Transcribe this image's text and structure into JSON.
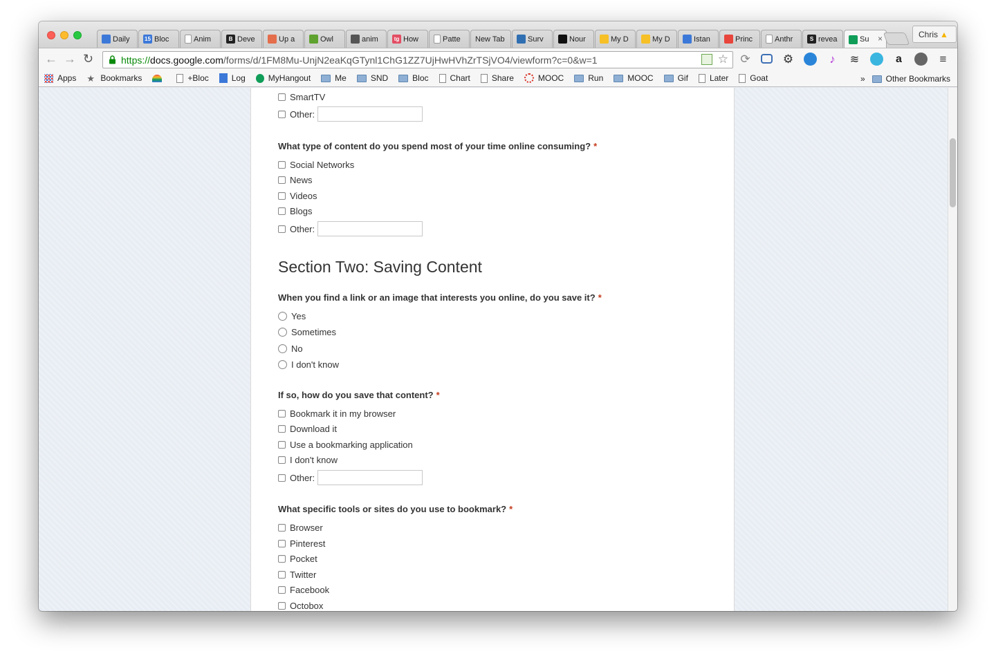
{
  "browser": {
    "tabs": [
      {
        "label": "Daily",
        "color": "#3c78d8"
      },
      {
        "label": "Bloc",
        "color": "#3c78d8",
        "badge": "15"
      },
      {
        "label": "Anim",
        "color": "#ffffff"
      },
      {
        "label": "Deve",
        "color": "#222222",
        "badge": "B"
      },
      {
        "label": "Up a",
        "color": "#e46d4b"
      },
      {
        "label": "Owl",
        "color": "#5fa22f"
      },
      {
        "label": "anim",
        "color": "#555555"
      },
      {
        "label": "How",
        "color": "#e34d63",
        "badge": "tg"
      },
      {
        "label": "Patte",
        "color": "#ffffff"
      },
      {
        "label": "New Tab",
        "color": ""
      },
      {
        "label": "Surv",
        "color": "#2f6fb1"
      },
      {
        "label": "Nour",
        "color": "#111111"
      },
      {
        "label": "My D",
        "color": "#f6c026"
      },
      {
        "label": "My D",
        "color": "#f6c026"
      },
      {
        "label": "Istan",
        "color": "#3c78d8"
      },
      {
        "label": "Princ",
        "color": "#e8453c"
      },
      {
        "label": "Anthr",
        "color": "#ffffff"
      },
      {
        "label": "revea",
        "color": "#222222",
        "badge": "S"
      },
      {
        "label": "Su",
        "color": "#0f9d58",
        "active": true
      }
    ],
    "profile_name": "Chris",
    "url_scheme": "https://",
    "url_host": "docs.google.com",
    "url_path": "/forms/d/1FM8Mu-UnjN2eaKqGTynl1ChG1ZZ7UjHwHVhZrTSjVO4/viewform?c=0&w=1",
    "bookmarks": [
      {
        "label": "Apps",
        "icon": "apps-icon"
      },
      {
        "label": "Bookmarks",
        "icon": "star-icon"
      },
      {
        "label": "",
        "icon": "rainbow-icon"
      },
      {
        "label": "+Bloc",
        "icon": "page-icon"
      },
      {
        "label": "Log",
        "icon": "doc-icon"
      },
      {
        "label": "MyHangout",
        "icon": "hangout-icon"
      },
      {
        "label": "Me",
        "icon": "folder-icon"
      },
      {
        "label": "SND",
        "icon": "folder-icon"
      },
      {
        "label": "Bloc",
        "icon": "folder-icon"
      },
      {
        "label": "Chart",
        "icon": "page-icon"
      },
      {
        "label": "Share",
        "icon": "page-icon"
      },
      {
        "label": "MOOC",
        "icon": "mooc-icon"
      },
      {
        "label": "Run",
        "icon": "folder-icon"
      },
      {
        "label": "MOOC",
        "icon": "folder-icon"
      },
      {
        "label": "Gif",
        "icon": "folder-icon"
      },
      {
        "label": "Later",
        "icon": "page-icon"
      },
      {
        "label": "Goat",
        "icon": "page-icon"
      }
    ],
    "overflow_label": "»",
    "other_bookmarks": "Other Bookmarks"
  },
  "form": {
    "prev_options": [
      {
        "label": "SmartTV"
      },
      {
        "label": "Other:"
      }
    ],
    "q_content": {
      "text": "What type of content do you spend most of your time online consuming?",
      "required": "*",
      "options": [
        "Social Networks",
        "News",
        "Videos",
        "Blogs",
        "Other:"
      ]
    },
    "section_title": "Section Two: Saving Content",
    "q_save": {
      "text": "When you find a link or an image that interests you online, do you save it?",
      "required": "*",
      "options": [
        "Yes",
        "Sometimes",
        "No",
        "I don't know"
      ]
    },
    "q_how": {
      "text": "If so, how do you save that content?",
      "required": "*",
      "options": [
        "Bookmark it in my browser",
        "Download it",
        "Use a bookmarking application",
        "I don't know",
        "Other:"
      ]
    },
    "q_tools": {
      "text": "What specific tools or sites do you use to bookmark?",
      "required": "*",
      "options": [
        "Browser",
        "Pinterest",
        "Pocket",
        "Twitter",
        "Facebook",
        "Octobox"
      ]
    }
  }
}
